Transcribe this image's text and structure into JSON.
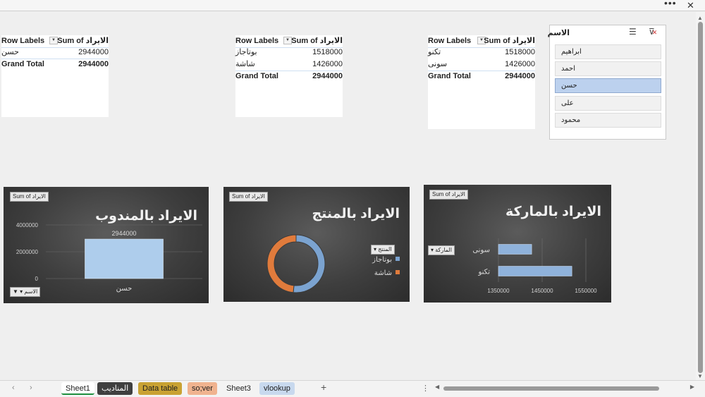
{
  "window": {
    "more_glyph": "•••",
    "close_glyph": "✕"
  },
  "pivots": [
    {
      "header_label": "Row Labels",
      "header_value": "Sum of الايراد",
      "rows": [
        {
          "label": "حسن",
          "value": "2944000"
        }
      ],
      "total_label": "Grand Total",
      "total_value": "2944000",
      "filter_button": "▼"
    },
    {
      "header_label": "Row Labels",
      "header_value": "Sum of الايراد",
      "rows": [
        {
          "label": "بوتاجاز",
          "value": "1518000"
        },
        {
          "label": "شاشة",
          "value": "1426000"
        }
      ],
      "total_label": "Grand Total",
      "total_value": "2944000",
      "filter_button": "▼"
    },
    {
      "header_label": "Row Labels",
      "header_value": "Sum of الايراد",
      "rows": [
        {
          "label": "تكنو",
          "value": "1518000"
        },
        {
          "label": "سونى",
          "value": "1426000"
        }
      ],
      "total_label": "Grand Total",
      "total_value": "2944000",
      "filter_button": "▼"
    }
  ],
  "slicer": {
    "title": "الاسم",
    "items": [
      "ابراهيم",
      "احمد",
      "حسن",
      "على",
      "محمود"
    ],
    "selected": "حسن"
  },
  "charts": {
    "rep": {
      "field_button": "Sum of الايراد",
      "title": "الايراد بالمندوب",
      "axis_filter": "الاسم",
      "chart_data": {
        "type": "bar",
        "categories": [
          "حسن"
        ],
        "values": [
          2944000
        ],
        "data_labels": [
          "2944000"
        ],
        "y_ticks": [
          "4000000",
          "2000000",
          "0"
        ],
        "ylim": [
          0,
          4000000
        ]
      }
    },
    "product": {
      "field_button": "Sum of الايراد",
      "title": "الايراد بالمنتج",
      "legend_filter": "المنتج",
      "chart_data": {
        "type": "pie",
        "categories": [
          "بوتاجاز",
          "شاشة"
        ],
        "values": [
          1518000,
          1426000
        ],
        "colors": [
          "#7ba3d0",
          "#e07b3c"
        ]
      }
    },
    "brand": {
      "field_button": "Sum of الايراد",
      "title": "الايراد بالماركة",
      "axis_filter": "الماركة",
      "chart_data": {
        "type": "bar",
        "orientation": "horizontal",
        "categories": [
          "سونى",
          "تكنو"
        ],
        "values": [
          1426000,
          1518000
        ],
        "x_ticks": [
          "1350000",
          "1450000",
          "1550000"
        ],
        "xlim": [
          1350000,
          1550000
        ]
      }
    }
  },
  "tabs": [
    {
      "label": "Sheet1",
      "active": true,
      "color": "#ffffff"
    },
    {
      "label": "المناديب",
      "color": "#3f3f3f",
      "text_color": "#ffffff"
    },
    {
      "label": "Data table",
      "color": "#c9a233"
    },
    {
      "label": "so;ver",
      "color": "#f0b38f"
    },
    {
      "label": "Sheet3",
      "color": "#efefef"
    },
    {
      "label": "vlookup",
      "color": "#c8d9ee"
    }
  ],
  "tabbar": {
    "prev": "‹",
    "next": "›",
    "add": "+",
    "options": "⋮",
    "scroll_left": "◀",
    "scroll_right": "▶"
  },
  "vscroll": {
    "up": "▲",
    "down": "▼"
  }
}
